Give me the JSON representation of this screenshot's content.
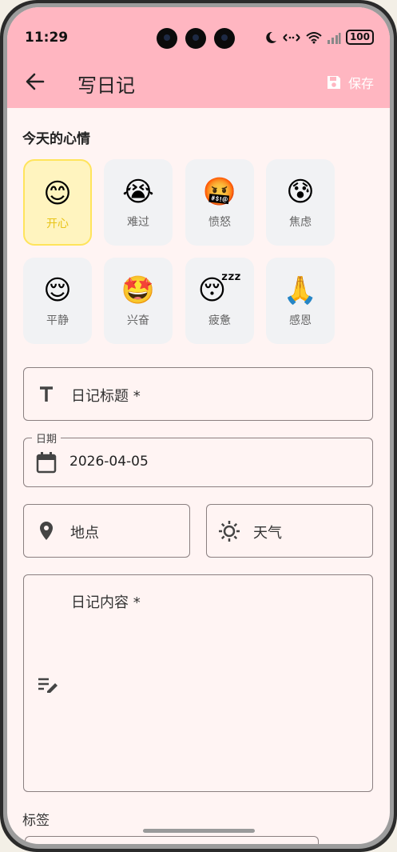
{
  "status": {
    "time": "11:29",
    "battery": "100"
  },
  "appbar": {
    "title": "写日记",
    "save_label": "保存"
  },
  "mood_section": {
    "title": "今天的心情"
  },
  "moods": [
    {
      "emoji": "😊",
      "label": "开心",
      "selected": true
    },
    {
      "emoji": "😭",
      "label": "难过"
    },
    {
      "emoji": "🤬",
      "label": "愤怒"
    },
    {
      "emoji": "😰",
      "label": "焦虑"
    },
    {
      "emoji": "😌",
      "label": "平静"
    },
    {
      "emoji": "🤩",
      "label": "兴奋"
    },
    {
      "emoji": "😴",
      "label": "疲惫"
    },
    {
      "emoji": "🙏",
      "label": "感恩"
    }
  ],
  "form": {
    "title_placeholder": "日记标题 *",
    "date_label": "日期",
    "date_value": "2026-04-05",
    "location_placeholder": "地点",
    "weather_placeholder": "天气",
    "content_placeholder": "日记内容 *",
    "tags_label": "标签"
  },
  "colors": {
    "appbar": "#ffb6c1",
    "background": "#fff4f3",
    "selected_bg": "#fff4bf",
    "selected_border": "#ffe45c",
    "selected_label": "#e8c418"
  }
}
